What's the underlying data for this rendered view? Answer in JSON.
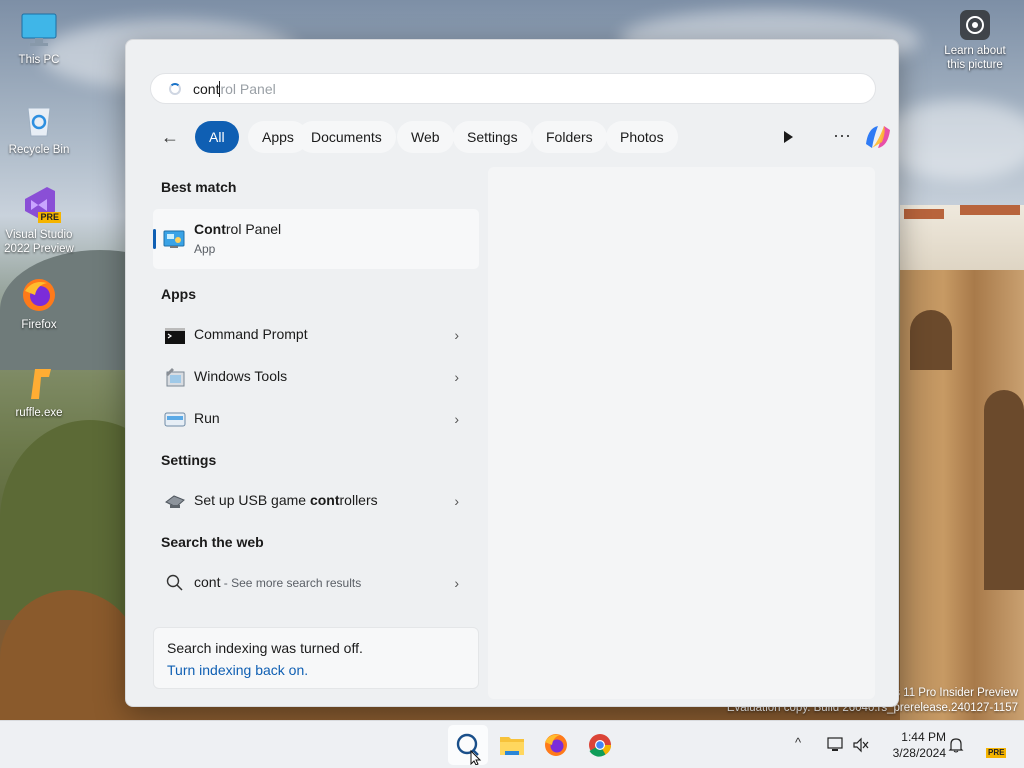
{
  "desktop": {
    "icons": [
      {
        "label": "This PC",
        "icon": "monitor-icon"
      },
      {
        "label": "Recycle Bin",
        "icon": "recycle-bin-icon"
      },
      {
        "label": "Visual Studio 2022 Preview",
        "icon": "visual-studio-icon",
        "badge": "PRE"
      },
      {
        "label": "Firefox",
        "icon": "firefox-icon"
      },
      {
        "label": "ruffle.exe",
        "icon": "ruffle-icon"
      }
    ],
    "learn_picture": "Learn about this picture",
    "watermark": {
      "line1": "Windows 11 Pro Insider Preview",
      "line2": "Evaluation copy. Build 26040.rs_prerelease.240127-1157"
    }
  },
  "search": {
    "typed": "cont",
    "completion": "rol Panel",
    "filters": [
      {
        "label": "All",
        "active": true
      },
      {
        "label": "Apps"
      },
      {
        "label": "Documents"
      },
      {
        "label": "Web"
      },
      {
        "label": "Settings"
      },
      {
        "label": "Folders"
      },
      {
        "label": "Photos"
      }
    ],
    "more_glyph": "···",
    "back_glyph": "←"
  },
  "results": {
    "best_match_heading": "Best match",
    "best_match": {
      "bold": "Cont",
      "rest": "rol Panel",
      "type": "App"
    },
    "apps_heading": "Apps",
    "apps": [
      {
        "label": "Command Prompt",
        "icon": "command-prompt-icon"
      },
      {
        "label": "Windows Tools",
        "icon": "windows-tools-icon"
      },
      {
        "label": "Run",
        "icon": "run-icon"
      }
    ],
    "settings_heading": "Settings",
    "settings": [
      {
        "prefix": "Set up USB game ",
        "bold": "cont",
        "suffix": "rollers",
        "icon": "game-controller-icon"
      }
    ],
    "web_heading": "Search the web",
    "web": {
      "query": "cont",
      "hint": " - See more search results"
    },
    "chevron": "›"
  },
  "indexing": {
    "message": "Search indexing was turned off.",
    "link": "Turn indexing back on."
  },
  "taskbar": {
    "time": "1:44 PM",
    "date": "3/28/2024",
    "tray_chevron": "^",
    "pre_badge": "PRE"
  },
  "colors": {
    "accent": "#0f5fb3",
    "panel_bg": "#eef0f2"
  }
}
